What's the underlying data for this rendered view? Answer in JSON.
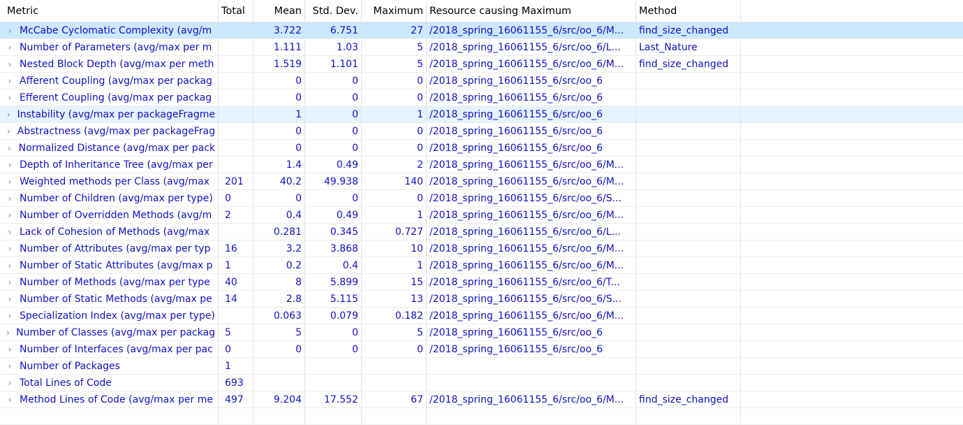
{
  "columns": {
    "metric": "Metric",
    "total": "Total",
    "mean": "Mean",
    "std": "Std. Dev.",
    "max": "Maximum",
    "resource": "Resource causing Maximum",
    "method": "Method"
  },
  "rows": [
    {
      "metric": "McCabe Cyclomatic Complexity (avg/m",
      "total": "",
      "mean": "3.722",
      "std": "6.751",
      "max": "27",
      "resource": "/2018_spring_16061155_6/src/oo_6/M...",
      "method": "find_size_changed",
      "state": "selected"
    },
    {
      "metric": "Number of Parameters (avg/max per m",
      "total": "",
      "mean": "1.111",
      "std": "1.03",
      "max": "5",
      "resource": "/2018_spring_16061155_6/src/oo_6/L...",
      "method": "Last_Nature",
      "state": ""
    },
    {
      "metric": "Nested Block Depth (avg/max per meth",
      "total": "",
      "mean": "1.519",
      "std": "1.101",
      "max": "5",
      "resource": "/2018_spring_16061155_6/src/oo_6/M...",
      "method": "find_size_changed",
      "state": ""
    },
    {
      "metric": "Afferent Coupling (avg/max per packag",
      "total": "",
      "mean": "0",
      "std": "0",
      "max": "0",
      "resource": "/2018_spring_16061155_6/src/oo_6",
      "method": "",
      "state": ""
    },
    {
      "metric": "Efferent Coupling (avg/max per packag",
      "total": "",
      "mean": "0",
      "std": "0",
      "max": "0",
      "resource": "/2018_spring_16061155_6/src/oo_6",
      "method": "",
      "state": ""
    },
    {
      "metric": "Instability (avg/max per packageFragme",
      "total": "",
      "mean": "1",
      "std": "0",
      "max": "1",
      "resource": "/2018_spring_16061155_6/src/oo_6",
      "method": "",
      "state": "hover"
    },
    {
      "metric": "Abstractness (avg/max per packageFrag",
      "total": "",
      "mean": "0",
      "std": "0",
      "max": "0",
      "resource": "/2018_spring_16061155_6/src/oo_6",
      "method": "",
      "state": ""
    },
    {
      "metric": "Normalized Distance (avg/max per pack",
      "total": "",
      "mean": "0",
      "std": "0",
      "max": "0",
      "resource": "/2018_spring_16061155_6/src/oo_6",
      "method": "",
      "state": ""
    },
    {
      "metric": "Depth of Inheritance Tree (avg/max per",
      "total": "",
      "mean": "1.4",
      "std": "0.49",
      "max": "2",
      "resource": "/2018_spring_16061155_6/src/oo_6/M...",
      "method": "",
      "state": ""
    },
    {
      "metric": "Weighted methods per Class (avg/max",
      "total": "201",
      "mean": "40.2",
      "std": "49.938",
      "max": "140",
      "resource": "/2018_spring_16061155_6/src/oo_6/M...",
      "method": "",
      "state": ""
    },
    {
      "metric": "Number of Children (avg/max per type)",
      "total": "0",
      "mean": "0",
      "std": "0",
      "max": "0",
      "resource": "/2018_spring_16061155_6/src/oo_6/S...",
      "method": "",
      "state": ""
    },
    {
      "metric": "Number of Overridden Methods (avg/m",
      "total": "2",
      "mean": "0.4",
      "std": "0.49",
      "max": "1",
      "resource": "/2018_spring_16061155_6/src/oo_6/M...",
      "method": "",
      "state": ""
    },
    {
      "metric": "Lack of Cohesion of Methods (avg/max",
      "total": "",
      "mean": "0.281",
      "std": "0.345",
      "max": "0.727",
      "resource": "/2018_spring_16061155_6/src/oo_6/L...",
      "method": "",
      "state": ""
    },
    {
      "metric": "Number of Attributes (avg/max per typ",
      "total": "16",
      "mean": "3.2",
      "std": "3.868",
      "max": "10",
      "resource": "/2018_spring_16061155_6/src/oo_6/M...",
      "method": "",
      "state": ""
    },
    {
      "metric": "Number of Static Attributes (avg/max p",
      "total": "1",
      "mean": "0.2",
      "std": "0.4",
      "max": "1",
      "resource": "/2018_spring_16061155_6/src/oo_6/M...",
      "method": "",
      "state": ""
    },
    {
      "metric": "Number of Methods (avg/max per type",
      "total": "40",
      "mean": "8",
      "std": "5.899",
      "max": "15",
      "resource": "/2018_spring_16061155_6/src/oo_6/T...",
      "method": "",
      "state": ""
    },
    {
      "metric": "Number of Static Methods (avg/max pe",
      "total": "14",
      "mean": "2.8",
      "std": "5.115",
      "max": "13",
      "resource": "/2018_spring_16061155_6/src/oo_6/S...",
      "method": "",
      "state": ""
    },
    {
      "metric": "Specialization Index (avg/max per type)",
      "total": "",
      "mean": "0.063",
      "std": "0.079",
      "max": "0.182",
      "resource": "/2018_spring_16061155_6/src/oo_6/M...",
      "method": "",
      "state": ""
    },
    {
      "metric": "Number of Classes (avg/max per packag",
      "total": "5",
      "mean": "5",
      "std": "0",
      "max": "5",
      "resource": "/2018_spring_16061155_6/src/oo_6",
      "method": "",
      "state": ""
    },
    {
      "metric": "Number of Interfaces (avg/max per pac",
      "total": "0",
      "mean": "0",
      "std": "0",
      "max": "0",
      "resource": "/2018_spring_16061155_6/src/oo_6",
      "method": "",
      "state": ""
    },
    {
      "metric": "Number of Packages",
      "total": "1",
      "mean": "",
      "std": "",
      "max": "",
      "resource": "",
      "method": "",
      "state": ""
    },
    {
      "metric": "Total Lines of Code",
      "total": "693",
      "mean": "",
      "std": "",
      "max": "",
      "resource": "",
      "method": "",
      "state": ""
    },
    {
      "metric": "Method Lines of Code (avg/max per me",
      "total": "497",
      "mean": "9.204",
      "std": "17.552",
      "max": "67",
      "resource": "/2018_spring_16061155_6/src/oo_6/M...",
      "method": "find_size_changed",
      "state": ""
    }
  ],
  "icons": {
    "expand": "chevron-right-icon"
  }
}
